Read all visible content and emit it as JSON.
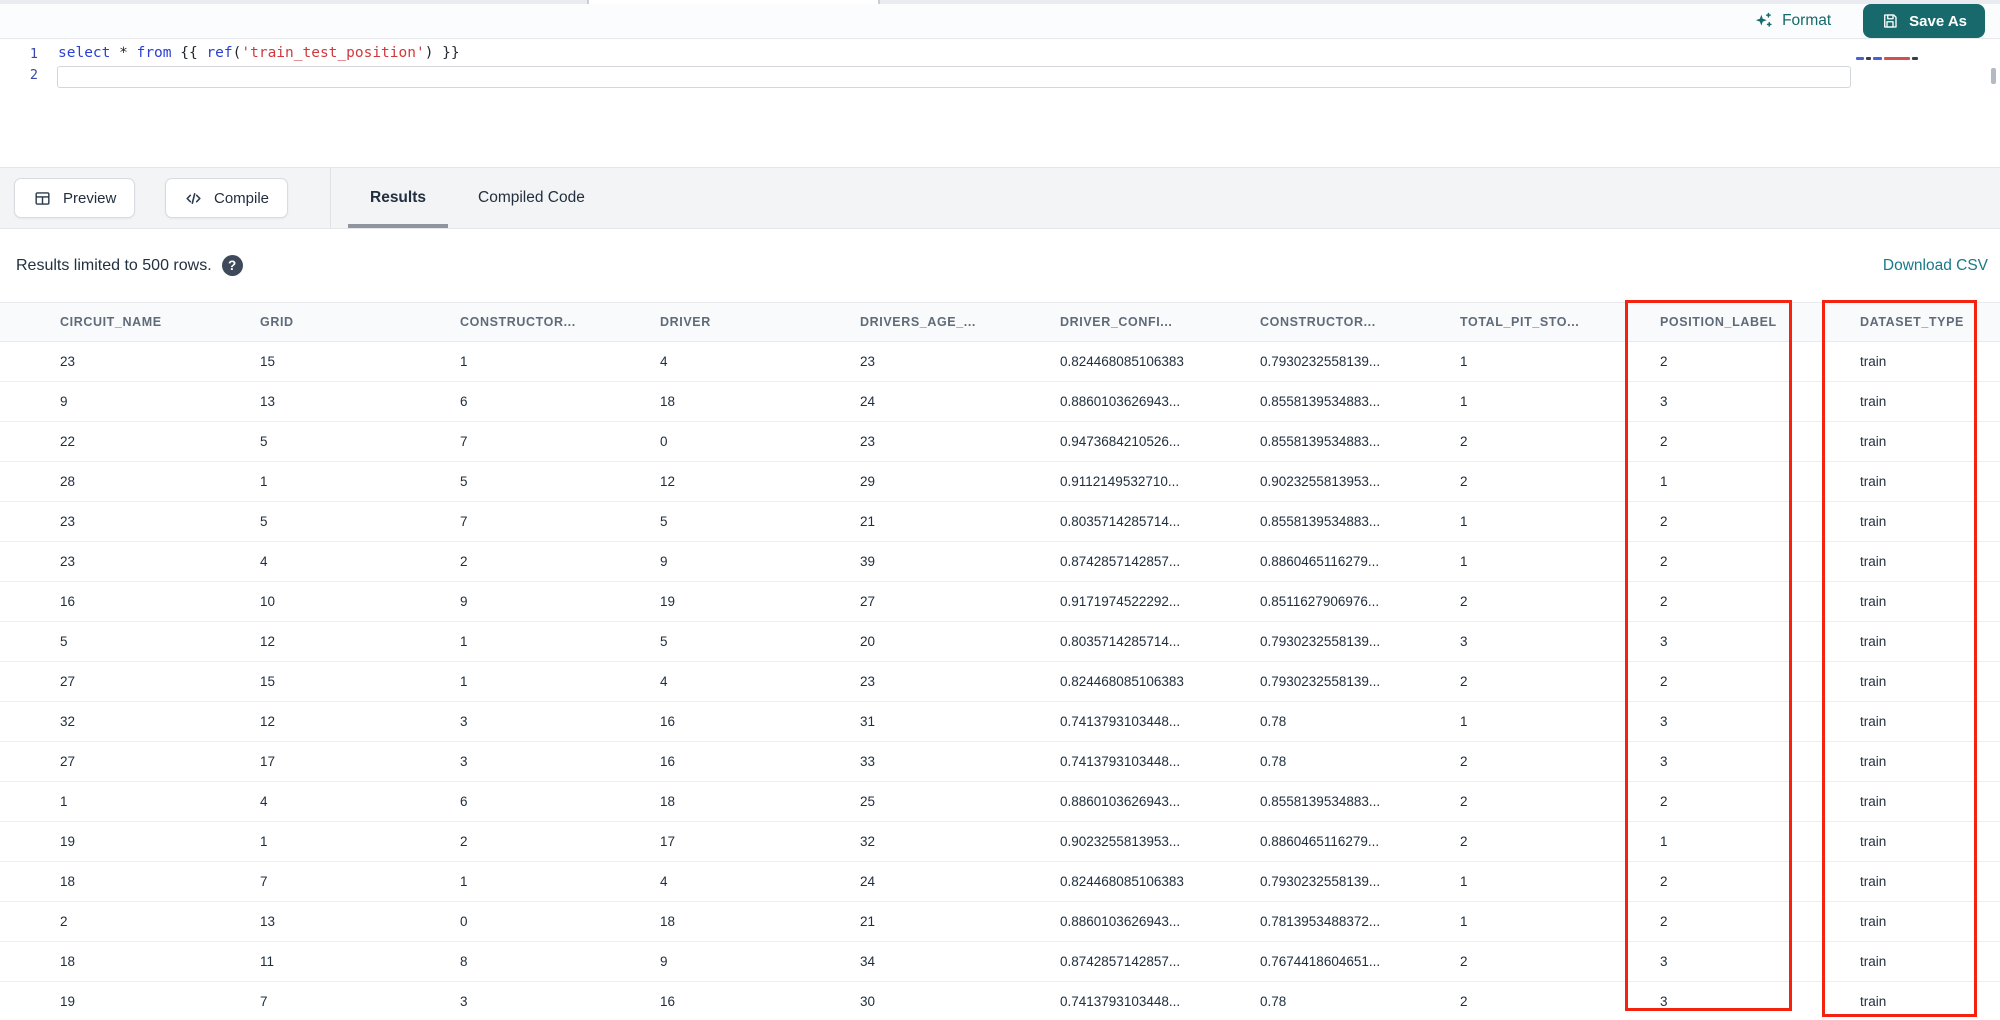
{
  "toolbar": {
    "format_label": "Format",
    "save_as_label": "Save As"
  },
  "editor": {
    "line_numbers": [
      "1",
      "2"
    ],
    "code_line": "select * from {{ ref('train_test_position') }}",
    "tokens": [
      {
        "text": "select",
        "type": "keyword"
      },
      {
        "text": " * ",
        "type": "plain"
      },
      {
        "text": "from",
        "type": "keyword"
      },
      {
        "text": " {{ ",
        "type": "plain"
      },
      {
        "text": "ref",
        "type": "function"
      },
      {
        "text": "(",
        "type": "plain"
      },
      {
        "text": "'train_test_position'",
        "type": "string"
      },
      {
        "text": ")",
        "type": "plain"
      },
      {
        "text": " }}",
        "type": "plain"
      }
    ]
  },
  "actions": {
    "preview_label": "Preview",
    "compile_label": "Compile"
  },
  "tabs": [
    {
      "label": "Results",
      "active": true
    },
    {
      "label": "Compiled Code",
      "active": false
    }
  ],
  "results": {
    "limit_text": "Results limited to 500 rows.",
    "help_glyph": "?",
    "download_label": "Download CSV"
  },
  "table": {
    "columns": [
      "CIRCUIT_NAME",
      "GRID",
      "CONSTRUCTOR...",
      "DRIVER",
      "DRIVERS_AGE_...",
      "DRIVER_CONFI...",
      "CONSTRUCTOR...",
      "TOTAL_PIT_STO...",
      "POSITION_LABEL",
      "DATASET_TYPE"
    ],
    "highlighted_columns": [
      "POSITION_LABEL",
      "DATASET_TYPE"
    ],
    "rows": [
      [
        "23",
        "15",
        "1",
        "4",
        "23",
        "0.824468085106383",
        "0.7930232558139...",
        "1",
        "2",
        "train"
      ],
      [
        "9",
        "13",
        "6",
        "18",
        "24",
        "0.8860103626943...",
        "0.8558139534883...",
        "1",
        "3",
        "train"
      ],
      [
        "22",
        "5",
        "7",
        "0",
        "23",
        "0.9473684210526...",
        "0.8558139534883...",
        "2",
        "2",
        "train"
      ],
      [
        "28",
        "1",
        "5",
        "12",
        "29",
        "0.9112149532710...",
        "0.9023255813953...",
        "2",
        "1",
        "train"
      ],
      [
        "23",
        "5",
        "7",
        "5",
        "21",
        "0.8035714285714...",
        "0.8558139534883...",
        "1",
        "2",
        "train"
      ],
      [
        "23",
        "4",
        "2",
        "9",
        "39",
        "0.8742857142857...",
        "0.8860465116279...",
        "1",
        "2",
        "train"
      ],
      [
        "16",
        "10",
        "9",
        "19",
        "27",
        "0.9171974522292...",
        "0.8511627906976...",
        "2",
        "2",
        "train"
      ],
      [
        "5",
        "12",
        "1",
        "5",
        "20",
        "0.8035714285714...",
        "0.7930232558139...",
        "3",
        "3",
        "train"
      ],
      [
        "27",
        "15",
        "1",
        "4",
        "23",
        "0.824468085106383",
        "0.7930232558139...",
        "2",
        "2",
        "train"
      ],
      [
        "32",
        "12",
        "3",
        "16",
        "31",
        "0.7413793103448...",
        "0.78",
        "1",
        "3",
        "train"
      ],
      [
        "27",
        "17",
        "3",
        "16",
        "33",
        "0.7413793103448...",
        "0.78",
        "2",
        "3",
        "train"
      ],
      [
        "1",
        "4",
        "6",
        "18",
        "25",
        "0.8860103626943...",
        "0.8558139534883...",
        "2",
        "2",
        "train"
      ],
      [
        "19",
        "1",
        "2",
        "17",
        "32",
        "0.9023255813953...",
        "0.8860465116279...",
        "2",
        "1",
        "train"
      ],
      [
        "18",
        "7",
        "1",
        "4",
        "24",
        "0.824468085106383",
        "0.7930232558139...",
        "1",
        "2",
        "train"
      ],
      [
        "2",
        "13",
        "0",
        "18",
        "21",
        "0.8860103626943...",
        "0.7813953488372...",
        "1",
        "2",
        "train"
      ],
      [
        "18",
        "11",
        "8",
        "9",
        "34",
        "0.8742857142857...",
        "0.7674418604651...",
        "2",
        "3",
        "train"
      ],
      [
        "19",
        "7",
        "3",
        "16",
        "30",
        "0.7413793103448...",
        "0.78",
        "2",
        "3",
        "train"
      ]
    ]
  },
  "colors": {
    "accent_teal": "#17696b",
    "link_teal": "#17798a",
    "highlight_red": "#f3230f",
    "keyword_blue": "#2a3fd4",
    "string_red": "#d0393e",
    "header_gray": "#5f6b7a",
    "text_dark": "#1c2a3a"
  }
}
